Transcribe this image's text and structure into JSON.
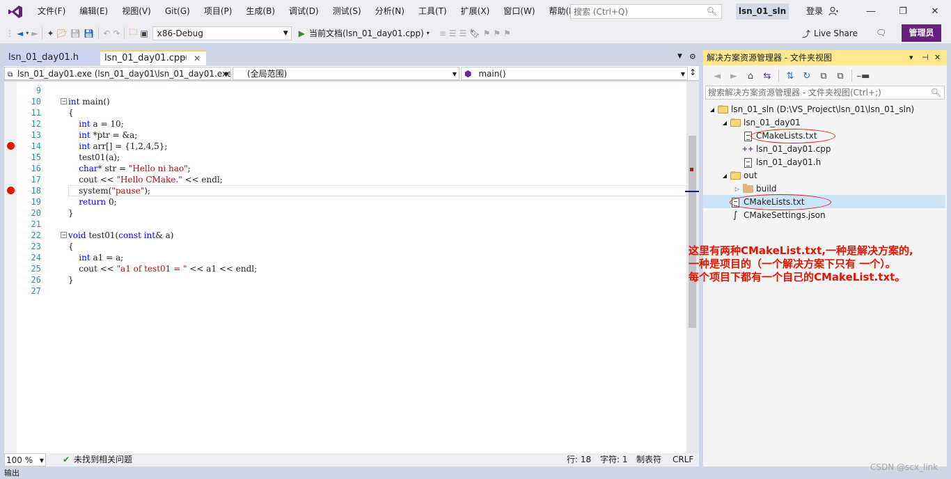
{
  "menu": {
    "items": [
      "文件(F)",
      "编辑(E)",
      "视图(V)",
      "Git(G)",
      "项目(P)",
      "生成(B)",
      "调试(D)",
      "测试(S)",
      "分析(N)",
      "工具(T)",
      "扩展(X)",
      "窗口(W)",
      "帮助(H)"
    ],
    "search_placeholder": "搜索 (Ctrl+Q)",
    "solution_name": "lsn_01_sln",
    "login": "登录"
  },
  "toolbar": {
    "config": "x86-Debug",
    "run_target": "当前文档(lsn_01_day01.cpp)",
    "live_share": "Live Share",
    "admin": "管理员"
  },
  "editor": {
    "tabs": [
      {
        "label": "lsn_01_day01.h",
        "active": false
      },
      {
        "label": "lsn_01_day01.cpp",
        "active": true
      }
    ],
    "nav": {
      "project": "lsn_01_day01.exe (lsn_01_day01\\lsn_01_day01.exe)",
      "scope": "(全局范围)",
      "member": "main()"
    },
    "breakpoint_lines": [
      14,
      18
    ],
    "current_line": 18,
    "lines": [
      {
        "n": "9",
        "text": ""
      },
      {
        "n": "10",
        "text": "int main()"
      },
      {
        "n": "11",
        "text": "{"
      },
      {
        "n": "12",
        "text": "    int a = 10;"
      },
      {
        "n": "13",
        "text": "    int *ptr = &a;"
      },
      {
        "n": "14",
        "text": "    int arr[] = {1,2,4,5};"
      },
      {
        "n": "15",
        "text": "    test01(a);"
      },
      {
        "n": "16",
        "text": "    char* str = \"Hello ni hao\";"
      },
      {
        "n": "17",
        "text": "    cout << \"Hello CMake.\" << endl;"
      },
      {
        "n": "18",
        "text": "    system(\"pause\");"
      },
      {
        "n": "19",
        "text": "    return 0;"
      },
      {
        "n": "20",
        "text": "}"
      },
      {
        "n": "21",
        "text": ""
      },
      {
        "n": "22",
        "text": "void test01(const int& a)"
      },
      {
        "n": "23",
        "text": "{"
      },
      {
        "n": "24",
        "text": "    int a1 = a;"
      },
      {
        "n": "25",
        "text": "    cout << \"a1 of test01 = \" << a1 << endl;"
      },
      {
        "n": "26",
        "text": "}"
      },
      {
        "n": "27",
        "text": ""
      }
    ],
    "status": {
      "zoom": "100 %",
      "issues": "未找到相关问题",
      "line": "行: 18",
      "col": "字符: 1",
      "tabs": "制表符",
      "eol": "CRLF"
    }
  },
  "bottom_bar": {
    "label": "输出"
  },
  "solution_explorer": {
    "title": "解决方案资源管理器 - 文件夹视图",
    "search_placeholder": "搜索解决方案资源管理器 - 文件夹视图(Ctrl+;)",
    "tree": [
      {
        "label": "lsn_01_sln (D:\\VS_Project\\lsn_01\\lsn_01_sln)",
        "kind": "folder-open",
        "depth": 0,
        "arrow": "expanded"
      },
      {
        "label": "lsn_01_day01",
        "kind": "folder-open",
        "depth": 1,
        "arrow": "expanded"
      },
      {
        "label": "CMakeLists.txt",
        "kind": "file",
        "depth": 2,
        "arrow": "none"
      },
      {
        "label": "lsn_01_day01.cpp",
        "kind": "cpp",
        "depth": 2,
        "arrow": "none"
      },
      {
        "label": "lsn_01_day01.h",
        "kind": "file",
        "depth": 2,
        "arrow": "none"
      },
      {
        "label": "out",
        "kind": "folder-open",
        "depth": 1,
        "arrow": "expanded"
      },
      {
        "label": "build",
        "kind": "folder",
        "depth": 2,
        "arrow": "collapsed"
      },
      {
        "label": "CMakeLists.txt",
        "kind": "file",
        "depth": 1,
        "arrow": "none",
        "selected": true
      },
      {
        "label": "CMakeSettings.json",
        "kind": "json",
        "depth": 1,
        "arrow": "none"
      }
    ]
  },
  "annotation": {
    "line1": "这里有两种CMakeList.txt,一种是解决方案的,",
    "line2": "一种是项目的（一个解决方案下只有 一个）。",
    "line3": "每个项目下都有一个自己的CMakeList.txt。"
  },
  "watermark": "CSDN @scx_link",
  "colors": {
    "accent": "#68217a",
    "panel_header": "#ffe98f",
    "breakpoint": "#e51400",
    "keyword": "#0000ff",
    "string": "#a31515",
    "line_number": "#2b91af",
    "annotation": "#e51400"
  }
}
